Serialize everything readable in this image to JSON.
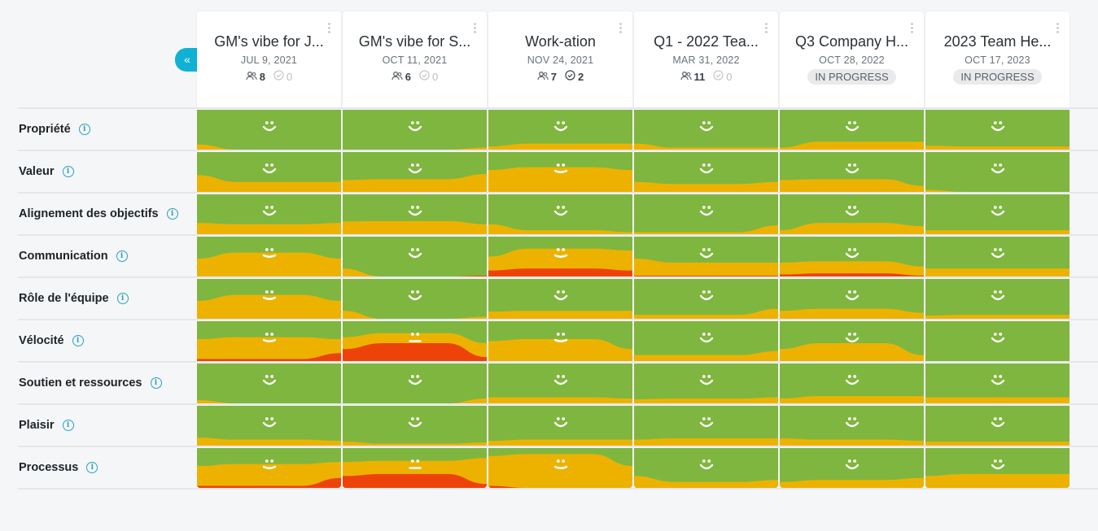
{
  "nav": {
    "collapse_icon": "«"
  },
  "colors": {
    "positive": "#7fb63f",
    "neutral": "#edb200",
    "negative": "#ee4308",
    "face": "#ffffff",
    "accent": "#0fb2d4"
  },
  "columns": [
    {
      "title": "GM's vibe for J...",
      "date": "JUL 9, 2021",
      "participants": "8",
      "actions": "0",
      "actions_dim": true,
      "status": null
    },
    {
      "title": "GM's vibe for S...",
      "date": "OCT 11, 2021",
      "participants": "6",
      "actions": "0",
      "actions_dim": true,
      "status": null
    },
    {
      "title": "Work-ation",
      "date": "NOV 24, 2021",
      "participants": "7",
      "actions": "2",
      "actions_dim": false,
      "status": null
    },
    {
      "title": "Q1 - 2022 Tea...",
      "date": "MAR 31, 2022",
      "participants": "11",
      "actions": "0",
      "actions_dim": true,
      "status": null
    },
    {
      "title": "Q3 Company H...",
      "date": "OCT 28, 2022",
      "participants": null,
      "actions": null,
      "actions_dim": true,
      "status": "IN PROGRESS"
    },
    {
      "title": "2023 Team He...",
      "date": "OCT 17, 2023",
      "participants": null,
      "actions": null,
      "actions_dim": true,
      "status": "IN PROGRESS"
    }
  ],
  "rows": [
    {
      "label": "Propriété",
      "faces": [
        "happy",
        "happy",
        "happy",
        "happy",
        "happy",
        "happy"
      ],
      "bands": [
        [
          [
            0.13,
            0.0
          ],
          [
            0.0,
            0.0
          ],
          [
            0.0,
            0.0
          ]
        ],
        [
          [
            0.0,
            0.0
          ],
          [
            0.0,
            0.0
          ],
          [
            0.05,
            0.0
          ]
        ],
        [
          [
            0.08,
            0.0
          ],
          [
            0.15,
            0.0
          ],
          [
            0.15,
            0.0
          ]
        ],
        [
          [
            0.15,
            0.0
          ],
          [
            0.05,
            0.0
          ],
          [
            0.05,
            0.0
          ]
        ],
        [
          [
            0.05,
            0.0
          ],
          [
            0.2,
            0.0
          ],
          [
            0.2,
            0.0
          ]
        ],
        [
          [
            0.1,
            0.0
          ],
          [
            0.08,
            0.0
          ],
          [
            0.08,
            0.0
          ]
        ]
      ]
    },
    {
      "label": "Valeur",
      "faces": [
        "happy",
        "happy",
        "mild",
        "happy",
        "happy",
        "happy"
      ],
      "bands": [
        [
          [
            0.42,
            0.0
          ],
          [
            0.25,
            0.0
          ],
          [
            0.25,
            0.0
          ]
        ],
        [
          [
            0.3,
            0.0
          ],
          [
            0.32,
            0.0
          ],
          [
            0.45,
            0.0
          ]
        ],
        [
          [
            0.55,
            0.0
          ],
          [
            0.62,
            0.0
          ],
          [
            0.55,
            0.0
          ]
        ],
        [
          [
            0.25,
            0.0
          ],
          [
            0.2,
            0.0
          ],
          [
            0.25,
            0.0
          ]
        ],
        [
          [
            0.3,
            0.0
          ],
          [
            0.32,
            0.0
          ],
          [
            0.15,
            0.0
          ]
        ],
        [
          [
            0.05,
            0.0
          ],
          [
            0.0,
            0.0
          ],
          [
            0.0,
            0.0
          ]
        ]
      ]
    },
    {
      "label": "Alignement des objectifs",
      "faces": [
        "happy",
        "happy",
        "happy",
        "happy",
        "happy",
        "happy"
      ],
      "bands": [
        [
          [
            0.28,
            0.0
          ],
          [
            0.25,
            0.0
          ],
          [
            0.28,
            0.0
          ]
        ],
        [
          [
            0.32,
            0.0
          ],
          [
            0.33,
            0.0
          ],
          [
            0.25,
            0.0
          ]
        ],
        [
          [
            0.25,
            0.0
          ],
          [
            0.1,
            0.0
          ],
          [
            0.05,
            0.0
          ]
        ],
        [
          [
            0.05,
            0.0
          ],
          [
            0.05,
            0.0
          ],
          [
            0.22,
            0.0
          ]
        ],
        [
          [
            0.1,
            0.0
          ],
          [
            0.28,
            0.0
          ],
          [
            0.2,
            0.0
          ]
        ],
        [
          [
            0.1,
            0.0
          ],
          [
            0.1,
            0.0
          ],
          [
            0.1,
            0.0
          ]
        ]
      ]
    },
    {
      "label": "Communication",
      "faces": [
        "mild",
        "happy",
        "mild",
        "happy",
        "happy",
        "happy"
      ],
      "bands": [
        [
          [
            0.45,
            0.0
          ],
          [
            0.6,
            0.0
          ],
          [
            0.45,
            0.0
          ]
        ],
        [
          [
            0.2,
            0.0
          ],
          [
            0.0,
            0.0
          ],
          [
            0.02,
            0.02
          ]
        ],
        [
          [
            0.5,
            0.15
          ],
          [
            0.7,
            0.2
          ],
          [
            0.65,
            0.15
          ]
        ],
        [
          [
            0.45,
            0.02
          ],
          [
            0.35,
            0.02
          ],
          [
            0.35,
            0.02
          ]
        ],
        [
          [
            0.35,
            0.05
          ],
          [
            0.38,
            0.08
          ],
          [
            0.25,
            0.02
          ]
        ],
        [
          [
            0.2,
            0.0
          ],
          [
            0.2,
            0.0
          ],
          [
            0.2,
            0.0
          ]
        ]
      ]
    },
    {
      "label": "Rôle de l'équipe",
      "faces": [
        "mild",
        "happy",
        "happy",
        "happy",
        "happy",
        "happy"
      ],
      "bands": [
        [
          [
            0.45,
            0.0
          ],
          [
            0.6,
            0.0
          ],
          [
            0.45,
            0.0
          ]
        ],
        [
          [
            0.2,
            0.0
          ],
          [
            0.0,
            0.0
          ],
          [
            0.05,
            0.0
          ]
        ],
        [
          [
            0.18,
            0.0
          ],
          [
            0.2,
            0.0
          ],
          [
            0.2,
            0.0
          ]
        ],
        [
          [
            0.1,
            0.0
          ],
          [
            0.1,
            0.0
          ],
          [
            0.25,
            0.0
          ]
        ],
        [
          [
            0.2,
            0.0
          ],
          [
            0.25,
            0.0
          ],
          [
            0.15,
            0.0
          ]
        ],
        [
          [
            0.08,
            0.0
          ],
          [
            0.1,
            0.0
          ],
          [
            0.1,
            0.0
          ]
        ]
      ]
    },
    {
      "label": "Vélocité",
      "faces": [
        "mild",
        "neutral",
        "mild",
        "happy",
        "happy",
        "happy"
      ],
      "bands": [
        [
          [
            0.55,
            0.05
          ],
          [
            0.6,
            0.05
          ],
          [
            0.55,
            0.2
          ]
        ],
        [
          [
            0.6,
            0.3
          ],
          [
            0.7,
            0.45
          ],
          [
            0.45,
            0.1
          ]
        ],
        [
          [
            0.5,
            0.0
          ],
          [
            0.55,
            0.0
          ],
          [
            0.3,
            0.0
          ]
        ],
        [
          [
            0.15,
            0.0
          ],
          [
            0.15,
            0.0
          ],
          [
            0.25,
            0.0
          ]
        ],
        [
          [
            0.3,
            0.0
          ],
          [
            0.45,
            0.0
          ],
          [
            0.15,
            0.0
          ]
        ],
        [
          [
            0.0,
            0.0
          ],
          [
            0.0,
            0.0
          ],
          [
            0.0,
            0.0
          ]
        ]
      ]
    },
    {
      "label": "Soutien et ressources",
      "faces": [
        "happy",
        "happy",
        "happy",
        "happy",
        "happy",
        "happy"
      ],
      "bands": [
        [
          [
            0.08,
            0.0
          ],
          [
            0.0,
            0.0
          ],
          [
            0.0,
            0.0
          ]
        ],
        [
          [
            0.0,
            0.0
          ],
          [
            0.0,
            0.0
          ],
          [
            0.12,
            0.0
          ]
        ],
        [
          [
            0.15,
            0.0
          ],
          [
            0.15,
            0.0
          ],
          [
            0.12,
            0.0
          ]
        ],
        [
          [
            0.1,
            0.0
          ],
          [
            0.12,
            0.0
          ],
          [
            0.15,
            0.0
          ]
        ],
        [
          [
            0.12,
            0.0
          ],
          [
            0.18,
            0.0
          ],
          [
            0.18,
            0.0
          ]
        ],
        [
          [
            0.15,
            0.0
          ],
          [
            0.15,
            0.0
          ],
          [
            0.15,
            0.0
          ]
        ]
      ]
    },
    {
      "label": "Plaisir",
      "faces": [
        "happy",
        "happy",
        "happy",
        "happy",
        "happy",
        "happy"
      ],
      "bands": [
        [
          [
            0.2,
            0.0
          ],
          [
            0.15,
            0.0
          ],
          [
            0.12,
            0.0
          ]
        ],
        [
          [
            0.1,
            0.0
          ],
          [
            0.05,
            0.0
          ],
          [
            0.08,
            0.0
          ]
        ],
        [
          [
            0.12,
            0.0
          ],
          [
            0.15,
            0.0
          ],
          [
            0.15,
            0.0
          ]
        ],
        [
          [
            0.15,
            0.0
          ],
          [
            0.18,
            0.0
          ],
          [
            0.18,
            0.0
          ]
        ],
        [
          [
            0.18,
            0.0
          ],
          [
            0.15,
            0.0
          ],
          [
            0.12,
            0.0
          ]
        ],
        [
          [
            0.1,
            0.0
          ],
          [
            0.1,
            0.0
          ],
          [
            0.1,
            0.0
          ]
        ]
      ]
    },
    {
      "label": "Processus",
      "faces": [
        "mild",
        "neutral",
        "mild",
        "happy",
        "happy",
        "happy"
      ],
      "bands": [
        [
          [
            0.55,
            0.05
          ],
          [
            0.6,
            0.05
          ],
          [
            0.65,
            0.25
          ]
        ],
        [
          [
            0.65,
            0.3
          ],
          [
            0.68,
            0.35
          ],
          [
            0.75,
            0.1
          ]
        ],
        [
          [
            0.8,
            0.05
          ],
          [
            0.85,
            0.0
          ],
          [
            0.55,
            0.0
          ]
        ],
        [
          [
            0.3,
            0.0
          ],
          [
            0.15,
            0.0
          ],
          [
            0.2,
            0.0
          ]
        ],
        [
          [
            0.15,
            0.0
          ],
          [
            0.2,
            0.0
          ],
          [
            0.25,
            0.0
          ]
        ],
        [
          [
            0.3,
            0.0
          ],
          [
            0.35,
            0.0
          ],
          [
            0.35,
            0.0
          ]
        ]
      ]
    }
  ]
}
